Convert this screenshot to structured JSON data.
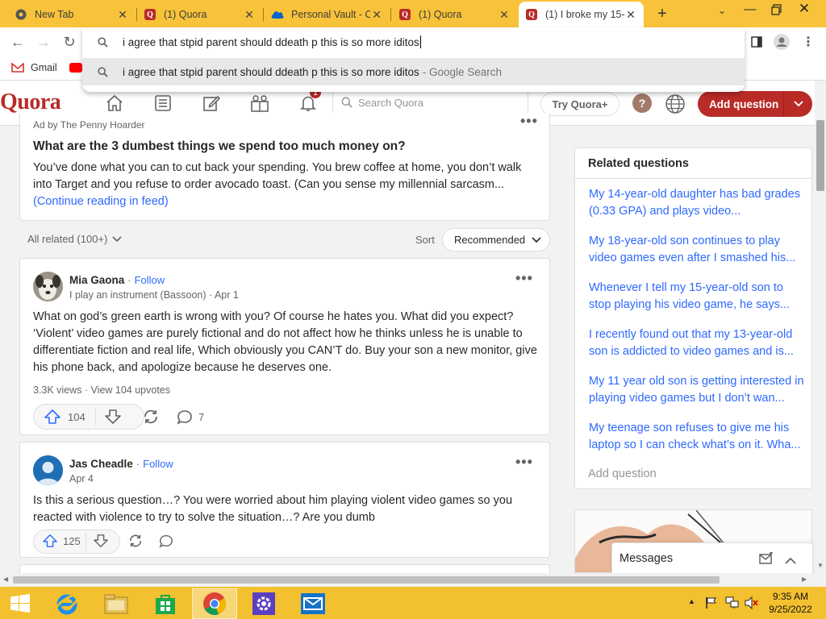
{
  "browser": {
    "tabs": [
      {
        "title": "New Tab",
        "icon": "chrome-icon"
      },
      {
        "title": "(1) Quora",
        "icon": "quora-icon"
      },
      {
        "title": "Personal Vault - O",
        "icon": "onedrive-icon"
      },
      {
        "title": "(1) Quora",
        "icon": "quora-icon"
      },
      {
        "title": "(1) I broke my 15-",
        "icon": "quora-icon"
      }
    ],
    "omnibox": {
      "query": "i agree that stpid parent should ddeath p this is so more iditos",
      "suggestion": "i agree that stpid parent should ddeath p this is so more iditos",
      "suggestion_suffix": "- Google Search"
    },
    "bookmarks": [
      {
        "label": "Gmail"
      }
    ]
  },
  "quora": {
    "logo": "Quora",
    "search_placeholder": "Search Quora",
    "try_plus": "Try Quora+",
    "help": "?",
    "add_question": "Add question",
    "notification_count": "1"
  },
  "ad": {
    "sponsor": "Ad by The Penny Hoarder",
    "title": "What are the 3 dumbest things we spend too much money on?",
    "body": "You’ve done what you can to cut back your spending. You brew coffee at home, you don’t walk into Target and you refuse to order avocado toast. (Can you sense my millennial sarcasm...",
    "continue": "(Continue reading in feed)"
  },
  "filters": {
    "all_related": "All related (100+)",
    "sort_label": "Sort",
    "sort_value": "Recommended"
  },
  "answers": [
    {
      "author": "Mia Gaona",
      "follow": "Follow",
      "credential": "I play an instrument (Bassoon) · Apr 1",
      "text": "What on god’s green earth is wrong with you? Of course he hates you. What did you expect? ‘Violent’ video games are purely fictional and do not affect how he thinks unless he is unable to differentiate fiction and real life, Which obviously you CAN’T do. Buy your son a new monitor, give his phone back, and apologize because he deserves one.",
      "stats": "3.3K views · View 104 upvotes",
      "upvotes": "104",
      "comments": "7"
    },
    {
      "author": "Jas Cheadle",
      "follow": "Follow",
      "credential": "Apr 4",
      "text": "Is this a serious question…? You were worried about him playing violent video games so you reacted with violence to try to solve the situation…? Are you dumb",
      "upvotes": "125"
    }
  ],
  "related": {
    "title": "Related questions",
    "items": [
      "My 14-year-old daughter has bad grades (0.33 GPA) and plays video...",
      "My 18-year-old son continues to play video games even after I smashed his...",
      "Whenever I tell my 15-year-old son to stop playing his video game, he says...",
      "I recently found out that my 13-year-old son is addicted to video games and is...",
      "My 11 year old son is getting interested in playing video games but I don’t wan...",
      "My teenage son refuses to give me his laptop so I can check what’s on it. Wha..."
    ],
    "add_question": "Add question"
  },
  "messages": {
    "label": "Messages"
  },
  "taskbar": {
    "time": "9:35 AM",
    "date": "9/25/2022"
  }
}
